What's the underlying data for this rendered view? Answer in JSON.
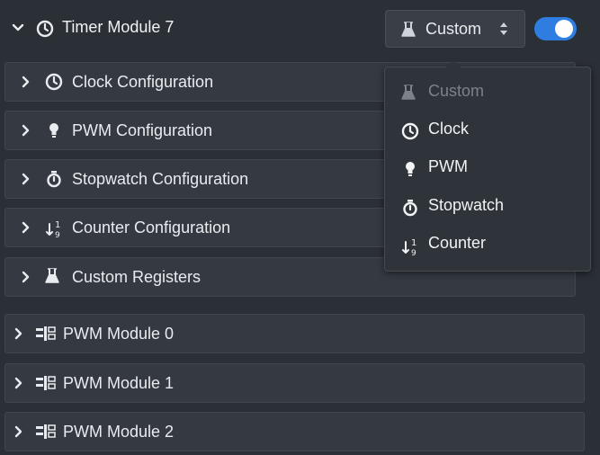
{
  "header": {
    "title": "Timer Module 7",
    "mode_select": {
      "value": "Custom"
    },
    "enabled": true
  },
  "sections": [
    {
      "label": "Clock Configuration",
      "icon": "clock-icon"
    },
    {
      "label": "PWM Configuration",
      "icon": "bulb-icon"
    },
    {
      "label": "Stopwatch Configuration",
      "icon": "stopwatch-icon"
    },
    {
      "label": "Counter Configuration",
      "icon": "sort-numeric-icon"
    },
    {
      "label": "Custom Registers",
      "icon": "flask-icon"
    }
  ],
  "dropdown": {
    "options": [
      {
        "label": "Custom",
        "icon": "flask-icon",
        "disabled": true
      },
      {
        "label": "Clock",
        "icon": "clock-icon"
      },
      {
        "label": "PWM",
        "icon": "bulb-icon"
      },
      {
        "label": "Stopwatch",
        "icon": "stopwatch-icon"
      },
      {
        "label": "Counter",
        "icon": "sort-numeric-icon"
      }
    ]
  },
  "modules": [
    {
      "label": "PWM Module 0",
      "icon": "sliders-icon"
    },
    {
      "label": "PWM Module 1",
      "icon": "sliders-icon"
    },
    {
      "label": "PWM Module 2",
      "icon": "sliders-icon"
    }
  ],
  "colors": {
    "background": "#2b2f36",
    "panel": "#353a42",
    "accent": "#2f7de1",
    "text": "#e9ecef",
    "muted": "#7b828a"
  }
}
